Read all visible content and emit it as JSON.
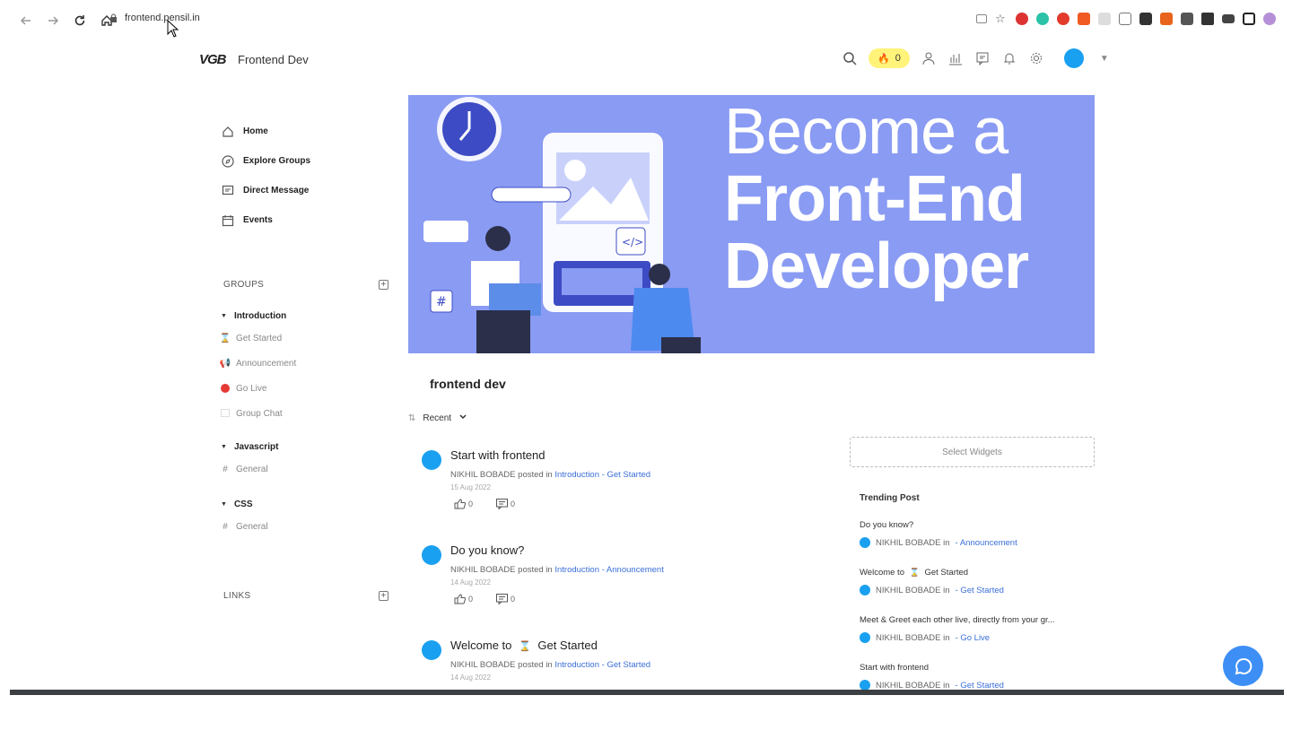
{
  "browser": {
    "url": "frontend.pensil.in"
  },
  "header": {
    "logo_text": "VGB",
    "app_name": "Frontend Dev",
    "streak_count": "0"
  },
  "sidebar": {
    "items": [
      {
        "label": "Home",
        "icon": "home-icon"
      },
      {
        "label": "Explore Groups",
        "icon": "compass-icon"
      },
      {
        "label": "Direct Message",
        "icon": "message-icon"
      },
      {
        "label": "Events",
        "icon": "calendar-icon"
      }
    ],
    "groups_title": "GROUPS",
    "links_title": "LINKS",
    "groups": [
      {
        "name": "Introduction",
        "channels": [
          {
            "label": "Get Started",
            "icon": "hourglass"
          },
          {
            "label": "Announcement",
            "icon": "megaphone"
          },
          {
            "label": "Go Live",
            "icon": "red-dot"
          },
          {
            "label": "Group Chat",
            "icon": "chat"
          }
        ]
      },
      {
        "name": "Javascript",
        "channels": [
          {
            "label": "General",
            "icon": "hash"
          }
        ]
      },
      {
        "name": "CSS",
        "channels": [
          {
            "label": "General",
            "icon": "hash"
          }
        ]
      }
    ]
  },
  "banner": {
    "line1": "Become a",
    "line2": "Front-End",
    "line3": "Developer"
  },
  "main": {
    "title": "frontend dev",
    "sort_label": "Recent",
    "posts": [
      {
        "title": "Start with frontend",
        "author": "NIKHIL BOBADE",
        "posted_in": "posted in",
        "group": "Introduction",
        "channel": "- Get Started",
        "date": "15 Aug 2022",
        "likes": "0",
        "comments": "0",
        "has_emoji": false
      },
      {
        "title": "Do you know?",
        "author": "NIKHIL BOBADE",
        "posted_in": "posted in",
        "group": "Introduction",
        "channel": "- Announcement",
        "date": "14 Aug 2022",
        "likes": "0",
        "comments": "0",
        "has_emoji": false
      },
      {
        "title_prefix": "Welcome to",
        "title_suffix": "Get Started",
        "author": "NIKHIL BOBADE",
        "posted_in": "posted in",
        "group": "Introduction",
        "channel": "- Get Started",
        "date": "14 Aug 2022",
        "has_emoji": true
      }
    ]
  },
  "widgets": {
    "select_label": "Select Widgets",
    "trending_title": "Trending Post",
    "trending": [
      {
        "title": "Do you know?",
        "author": "NIKHIL BOBADE in",
        "channel": "- Announcement"
      },
      {
        "title_prefix": "Welcome to",
        "title_suffix": "Get Started",
        "author": "NIKHIL BOBADE in",
        "channel": "- Get Started"
      },
      {
        "title": "Meet & Greet each other live, directly from your gr...",
        "author": "NIKHIL BOBADE in",
        "channel": "- Go Live"
      },
      {
        "title": "Start with frontend",
        "author": "NIKHIL BOBADE in",
        "channel": "- Get Started"
      }
    ]
  },
  "colors": {
    "accent": "#3b6fd8",
    "banner_bg": "#8a9bf3",
    "streak_bg": "#fff37a",
    "fab": "#3d8ff5"
  }
}
